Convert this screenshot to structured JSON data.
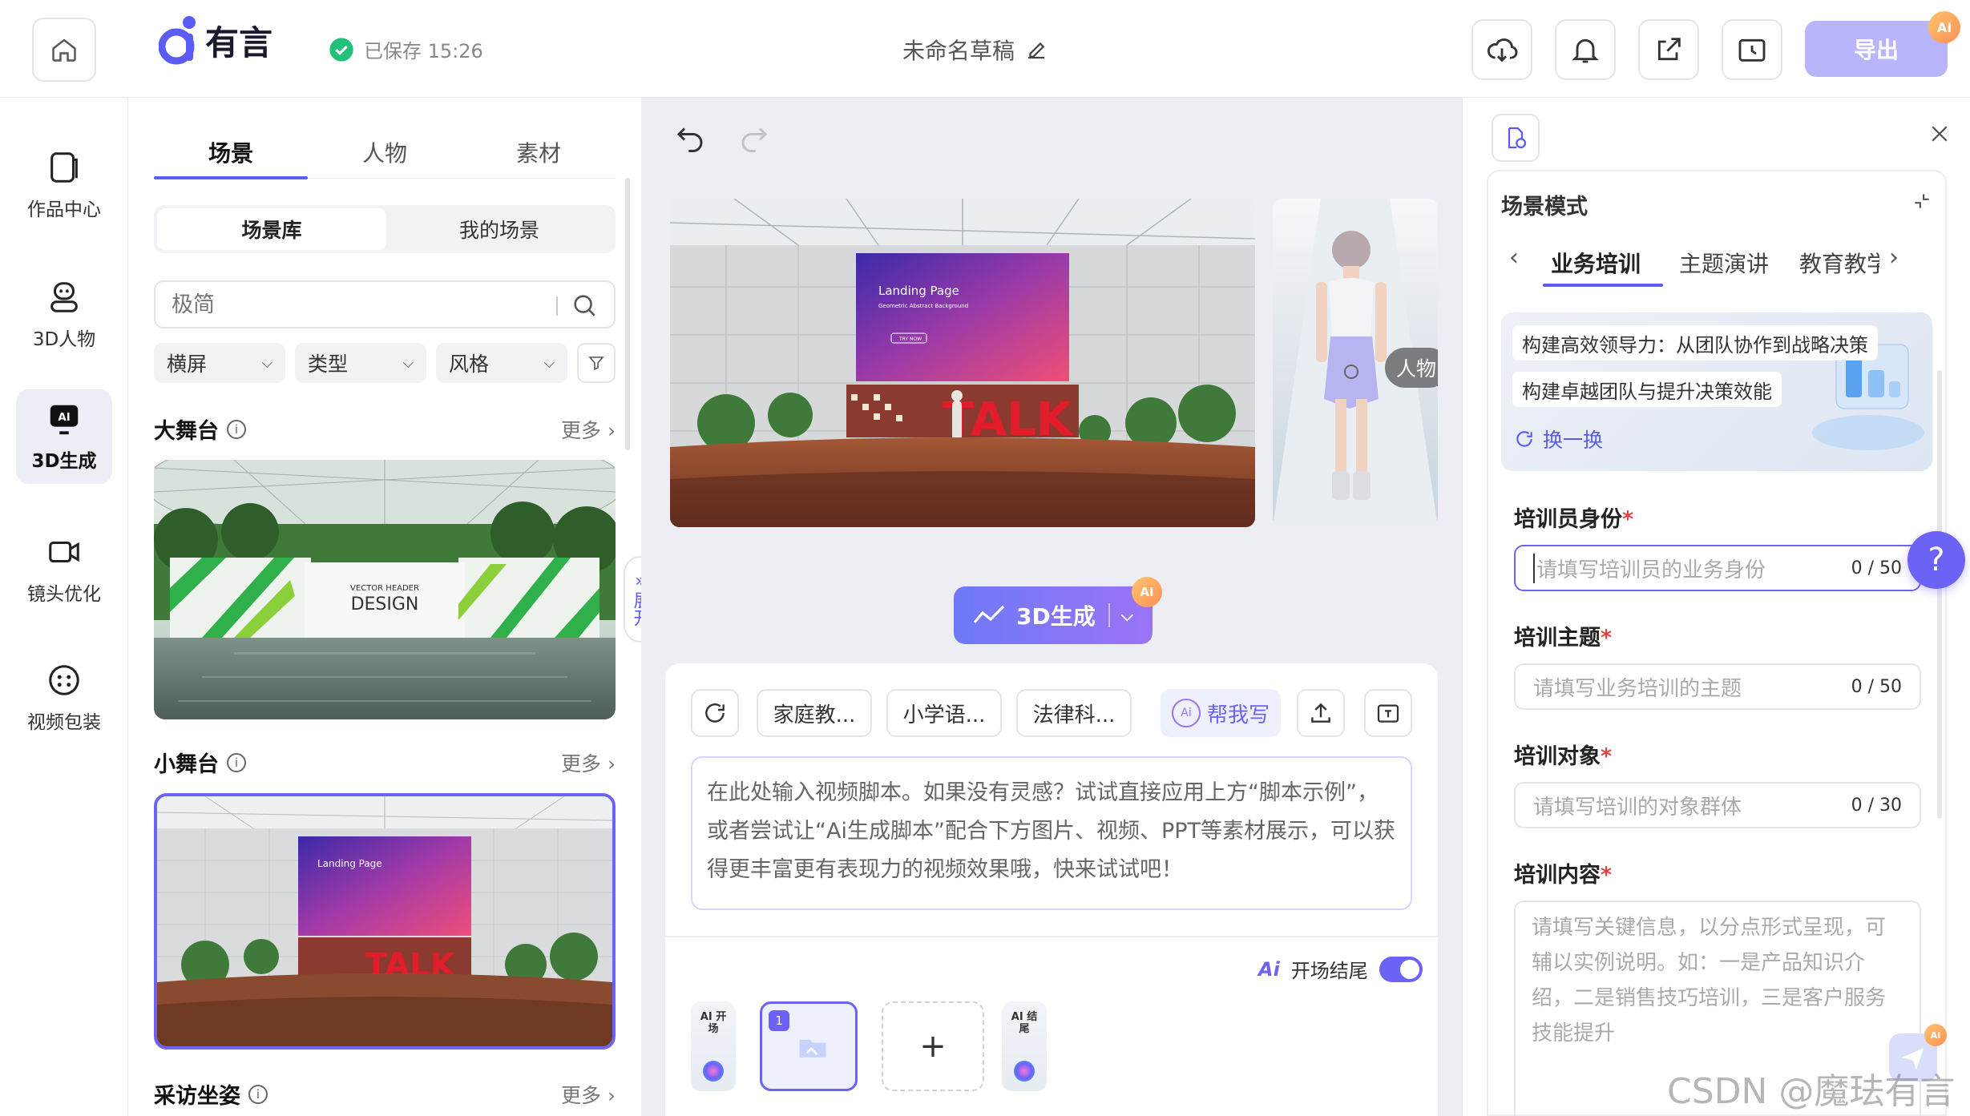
{
  "header": {
    "logo_text": "有言",
    "saved_status": "已保存 15:26",
    "doc_title": "未命名草稿",
    "export_label": "导出",
    "ai_badge": "AI"
  },
  "nav": {
    "items": [
      {
        "label": "作品中心"
      },
      {
        "label": "3D人物"
      },
      {
        "label": "3D生成"
      },
      {
        "label": "镜头优化"
      },
      {
        "label": "视频包装"
      }
    ]
  },
  "library": {
    "tabs": [
      "场景",
      "人物",
      "素材"
    ],
    "segments": [
      "场景库",
      "我的场景"
    ],
    "search_placeholder": "极简",
    "filters": [
      "横屏",
      "类型",
      "风格"
    ],
    "sections": [
      {
        "title": "大舞台",
        "more": "更多"
      },
      {
        "title": "小舞台",
        "more": "更多"
      },
      {
        "title": "采访坐姿",
        "more": "更多"
      }
    ],
    "expand_label": "展开",
    "card_big_text": "DESIGN",
    "card_big_sub": "VECTOR HEADER",
    "card_small_screen": "Landing Page",
    "card_small_talk": "TALK"
  },
  "canvas": {
    "preview_screen_title": "Landing Page",
    "preview_screen_sub": "Geometric Abstract Background",
    "preview_screen_btn": "TRY NOW",
    "preview_talk": "TALK",
    "character_tag": "人物",
    "generate_label": "3D生成",
    "script_chips": [
      "家庭教...",
      "小学语...",
      "法律科..."
    ],
    "help_write_label": "帮我写",
    "script_placeholder": "在此处输入视频脚本。如果没有灵感？试试直接应用上方“脚本示例”，或者尝试让“Ai生成脚本”配合下方图片、视频、PPT等素材展示，可以获得更丰富更有表现力的视频效果哦，快来试试吧！",
    "opening_ending_label": "开场结尾",
    "timeline": {
      "start_label": "AI 开场",
      "end_label": "AI 结尾",
      "clip_index": "1",
      "add_symbol": "+"
    }
  },
  "right_panel": {
    "mode_title": "场景模式",
    "mode_tabs": [
      "业务培训",
      "主题演讲",
      "教育教学"
    ],
    "suggestions": [
      "构建高效领导力：从团队协作到战略决策",
      "构建卓越团队与提升决策效能"
    ],
    "refresh_label": "换一换",
    "fields": [
      {
        "label": "培训员身份",
        "placeholder": "请填写培训员的业务身份",
        "counter": "0 / 50"
      },
      {
        "label": "培训主题",
        "placeholder": "请填写业务培训的主题",
        "counter": "0 / 50"
      },
      {
        "label": "培训对象",
        "placeholder": "请填写培训的对象群体",
        "counter": "0 / 30"
      },
      {
        "label": "培训内容",
        "placeholder": "请填写关键信息，以分点形式呈现，可辅以实例说明。如：一是产品知识介绍，二是销售技巧培训，三是客户服务技能提升",
        "counter": ""
      }
    ],
    "help_symbol": "?"
  },
  "watermark": "CSDN @魔珐有言"
}
